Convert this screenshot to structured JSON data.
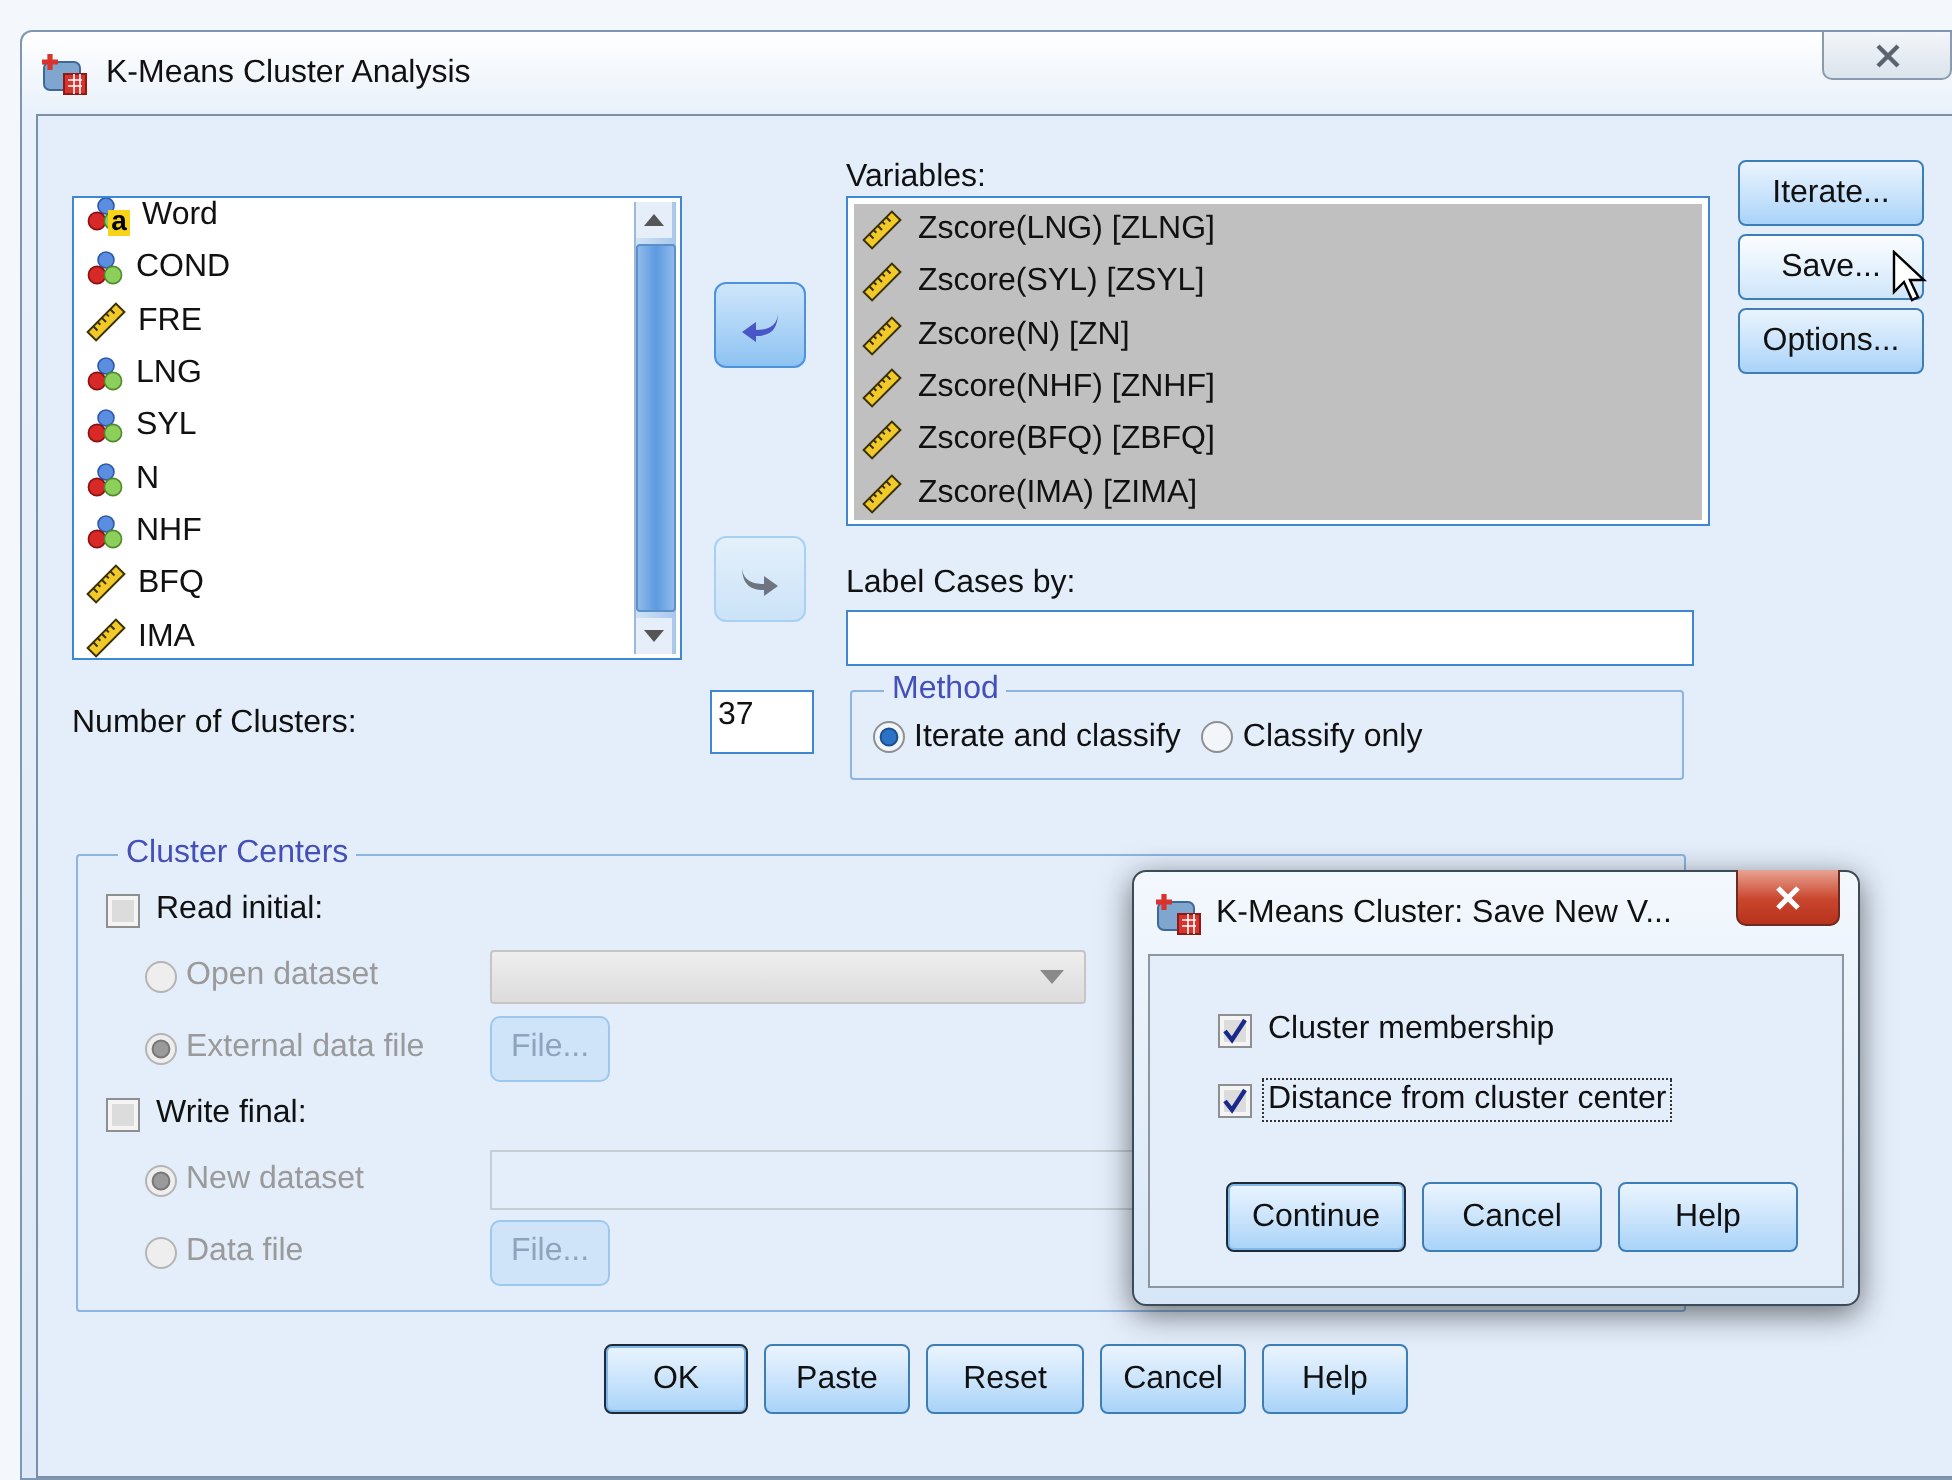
{
  "window": {
    "title": "K-Means Cluster Analysis"
  },
  "source_variables": [
    {
      "name": "Word",
      "kind": "string",
      "badge": "a"
    },
    {
      "name": "COND",
      "kind": "nominal"
    },
    {
      "name": "FRE",
      "kind": "scale"
    },
    {
      "name": "LNG",
      "kind": "nominal"
    },
    {
      "name": "SYL",
      "kind": "nominal"
    },
    {
      "name": "N",
      "kind": "nominal"
    },
    {
      "name": "NHF",
      "kind": "nominal"
    },
    {
      "name": "BFQ",
      "kind": "scale"
    },
    {
      "name": "IMA",
      "kind": "scale"
    }
  ],
  "move_buttons": [
    {
      "kind": "left",
      "disabled": false
    },
    {
      "kind": "right",
      "disabled": true
    }
  ],
  "variables": {
    "label": "Variables:",
    "items": [
      {
        "name": "Zscore(LNG) [ZLNG]",
        "kind": "scale",
        "selected": true
      },
      {
        "name": "Zscore(SYL) [ZSYL]",
        "kind": "scale",
        "selected": true
      },
      {
        "name": "Zscore(N) [ZN]",
        "kind": "scale",
        "selected": true
      },
      {
        "name": "Zscore(NHF) [ZNHF]",
        "kind": "scale",
        "selected": true
      },
      {
        "name": "Zscore(BFQ) [ZBFQ]",
        "kind": "scale",
        "selected": true
      },
      {
        "name": "Zscore(IMA) [ZIMA]",
        "kind": "scale",
        "selected": true
      }
    ]
  },
  "label_cases": {
    "label": "Label Cases by:"
  },
  "side_buttons": [
    {
      "label": "Iterate...",
      "hovered": false
    },
    {
      "label": "Save...",
      "hovered": true
    },
    {
      "label": "Options...",
      "hovered": false
    }
  ],
  "number_of_clusters": {
    "label": "Number of Clusters:",
    "value": "37"
  },
  "method": {
    "title": "Method",
    "options": [
      {
        "label": "Iterate and classify",
        "selected": true
      },
      {
        "label": "Classify only",
        "selected": false
      }
    ]
  },
  "cluster_centers": {
    "title": "Cluster Centers",
    "groups": [
      {
        "label": "Read initial:",
        "checked": false,
        "options": [
          {
            "label": "Open dataset",
            "selected": false,
            "kind": "dropdown"
          },
          {
            "label": "External data file",
            "selected": true,
            "kind": "file",
            "button": "File..."
          }
        ]
      },
      {
        "label": "Write final:",
        "checked": false,
        "options": [
          {
            "label": "New dataset",
            "selected": true,
            "kind": "text"
          },
          {
            "label": "Data file",
            "selected": false,
            "kind": "file",
            "button": "File..."
          }
        ]
      }
    ]
  },
  "buttons": [
    {
      "label": "OK",
      "default": true
    },
    {
      "label": "Paste",
      "default": false
    },
    {
      "label": "Reset",
      "default": false
    },
    {
      "label": "Cancel",
      "default": false
    },
    {
      "label": "Help",
      "default": false
    }
  ],
  "save_dialog": {
    "title": "K-Means Cluster: Save New V...",
    "options": [
      {
        "label": "Cluster membership",
        "checked": true,
        "focused": false
      },
      {
        "label": "Distance from cluster center",
        "checked": true,
        "focused": true
      }
    ],
    "buttons": [
      {
        "label": "Continue",
        "default": true
      },
      {
        "label": "Cancel",
        "default": false
      },
      {
        "label": "Help",
        "default": false
      }
    ]
  }
}
